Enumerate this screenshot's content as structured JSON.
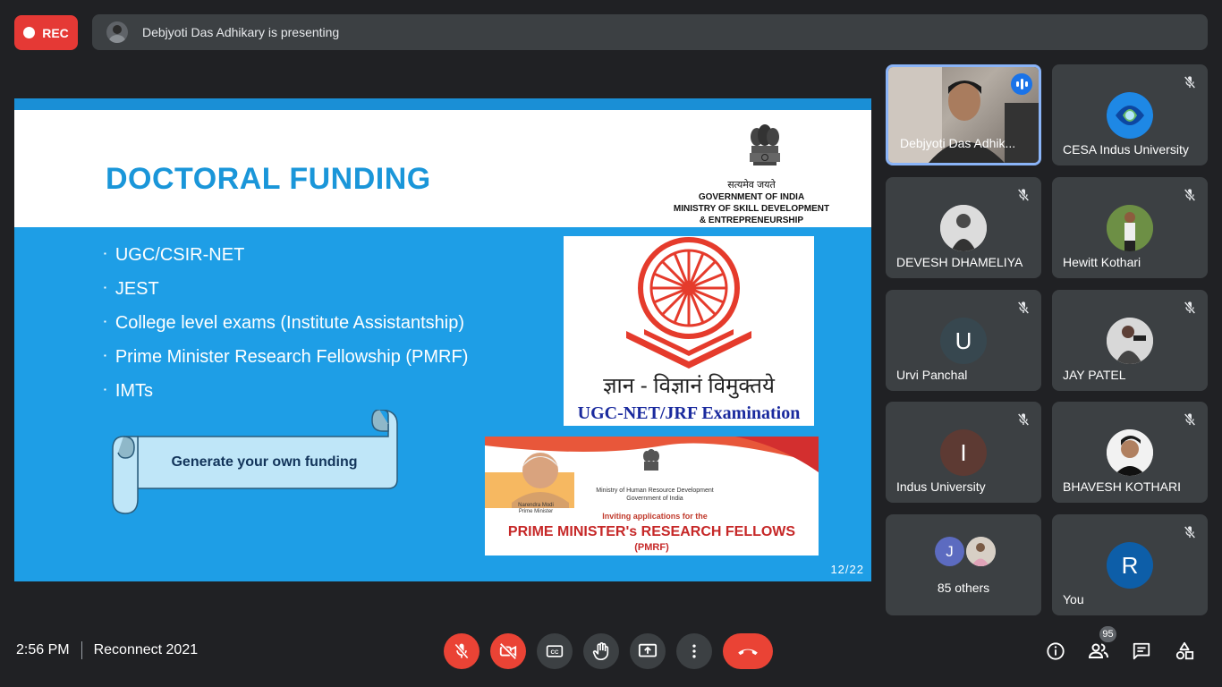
{
  "topbar": {
    "rec_label": "REC",
    "presenting_text": "Debjyoti Das Adhikary is presenting"
  },
  "slide": {
    "title": "DOCTORAL FUNDING",
    "emblem_motto": "सत्यमेव जयते",
    "gov_line1": "GOVERNMENT OF INDIA",
    "gov_line2": "MINISTRY OF SKILL DEVELOPMENT",
    "gov_line3": "& ENTREPRENEURSHIP",
    "bullets": [
      "UGC/CSIR-NET",
      "JEST",
      "College level exams (Institute Assistantship)",
      "Prime Minister Research Fellowship (PMRF)",
      "IMTs"
    ],
    "scroll_text": "Generate your own funding",
    "ugc_hindi": "ज्ञान - विज्ञानं विमुक्तये",
    "ugc_label": "UGC-NET/JRF Examination",
    "pmrf_ministry_line1": "Ministry of Human Resource Development",
    "pmrf_ministry_line2": "Government of India",
    "pmrf_pm_name": "Narendra Modi",
    "pmrf_pm_title": "Prime Minister",
    "pmrf_invite": "Inviting applications for the",
    "pmrf_title": "PRIME MINISTER's RESEARCH FELLOWS",
    "pmrf_abbr": "(PMRF)",
    "page_number": "12/22"
  },
  "participants": [
    {
      "name": "Debjyoti Das Adhik...",
      "initial": ""
    },
    {
      "name": "CESA Indus University",
      "initial": ""
    },
    {
      "name": "DEVESH DHAMELIYA",
      "initial": ""
    },
    {
      "name": "Hewitt Kothari",
      "initial": ""
    },
    {
      "name": "Urvi Panchal",
      "initial": "U"
    },
    {
      "name": "JAY PATEL",
      "initial": ""
    },
    {
      "name": "Indus University",
      "initial": "I"
    },
    {
      "name": "BHAVESH KOTHARI",
      "initial": ""
    },
    {
      "name": "85 others",
      "initial": "J"
    },
    {
      "name": "You",
      "initial": "R"
    }
  ],
  "colors": {
    "urvi_avatar": "#37474f",
    "indus_avatar": "#5d3a33",
    "you_avatar": "#0d5ea8",
    "others_avatar": "#5c6bc0",
    "accent_blue": "#8ab4f8",
    "danger_red": "#ea4335"
  },
  "bottombar": {
    "time": "2:56 PM",
    "meeting_name": "Reconnect 2021",
    "participant_count": "95"
  }
}
